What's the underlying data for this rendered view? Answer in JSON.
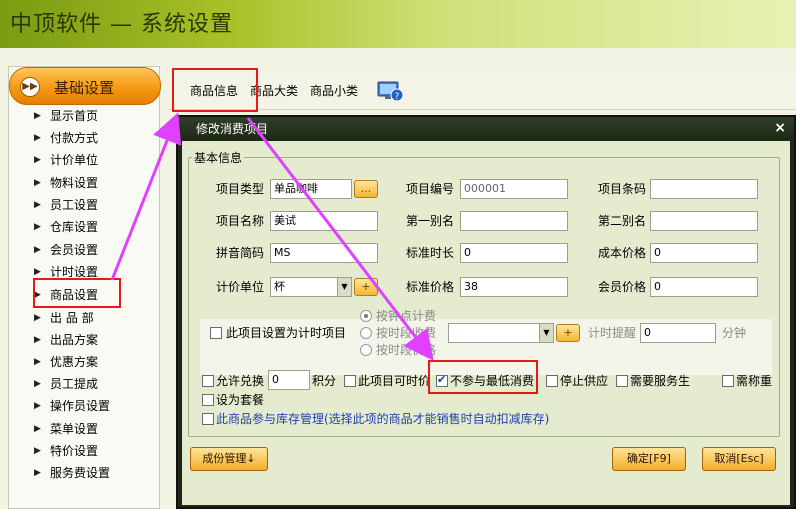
{
  "app": {
    "title": "中顶软件 — 系统设置"
  },
  "nav": {
    "header": "基础设置",
    "items": [
      {
        "label": "显示首页"
      },
      {
        "label": "付款方式"
      },
      {
        "label": "计价单位"
      },
      {
        "label": "物料设置"
      },
      {
        "label": "员工设置"
      },
      {
        "label": "仓库设置"
      },
      {
        "label": "会员设置"
      },
      {
        "label": "计时设置"
      },
      {
        "label": "商品设置"
      },
      {
        "label": "出 品 部"
      },
      {
        "label": "出品方案"
      },
      {
        "label": "优惠方案"
      },
      {
        "label": "员工提成"
      },
      {
        "label": "操作员设置"
      },
      {
        "label": "菜单设置"
      },
      {
        "label": "特价设置"
      },
      {
        "label": "服务费设置"
      }
    ]
  },
  "tabs": [
    {
      "label": "商品信息"
    },
    {
      "label": "商品大类"
    },
    {
      "label": "商品小类"
    }
  ],
  "dialog": {
    "title": "修改消费项目",
    "close": "×",
    "group_title": "基本信息",
    "fields": {
      "item_type": {
        "label": "项目类型",
        "value": "单品咖啡",
        "btn": "..."
      },
      "item_code": {
        "label": "项目编号",
        "value": "000001"
      },
      "barcode": {
        "label": "项目条码",
        "value": ""
      },
      "item_name": {
        "label": "项目名称",
        "value": "美试"
      },
      "alias1": {
        "label": "第一别名",
        "value": ""
      },
      "alias2": {
        "label": "第二别名",
        "value": ""
      },
      "pinyin": {
        "label": "拼音简码",
        "value": "MS"
      },
      "std_duration": {
        "label": "标准时长",
        "value": "0"
      },
      "cost_price": {
        "label": "成本价格",
        "value": "0"
      },
      "unit": {
        "label": "计价单位",
        "value": "杯",
        "btn": "+"
      },
      "std_price": {
        "label": "标准价格",
        "value": "38"
      },
      "member_price": {
        "label": "会员价格",
        "value": "0"
      }
    },
    "timed": {
      "checkbox": "此项目设置为计时项目",
      "radio1": "按钟点计费",
      "radio2": "按时段收费",
      "radio3": "按时段价格",
      "btn": "+",
      "reminder_label": "计时提醒",
      "reminder_value": "0",
      "minute": "分钟"
    },
    "options": {
      "exchange": "允许兑换",
      "exchange_value": "0",
      "points": "积分",
      "timeable": "此项目可时价",
      "no_min": "不参与最低消费",
      "stop": "停止供应",
      "service": "需要服务生",
      "weigh": "需称重",
      "set_meal": "设为套餐",
      "stock": "此商品参与库存管理(选择此项的商品才能销售时自动扣减库存)"
    },
    "buttons": {
      "cost_mgmt": "成份管理↓",
      "ok": "确定[F9]",
      "cancel": "取消[Esc]"
    }
  },
  "colors": {
    "accent_red": "#e81818",
    "arrow_magenta": "#e040ff",
    "nav_orange": "#f49a14"
  }
}
